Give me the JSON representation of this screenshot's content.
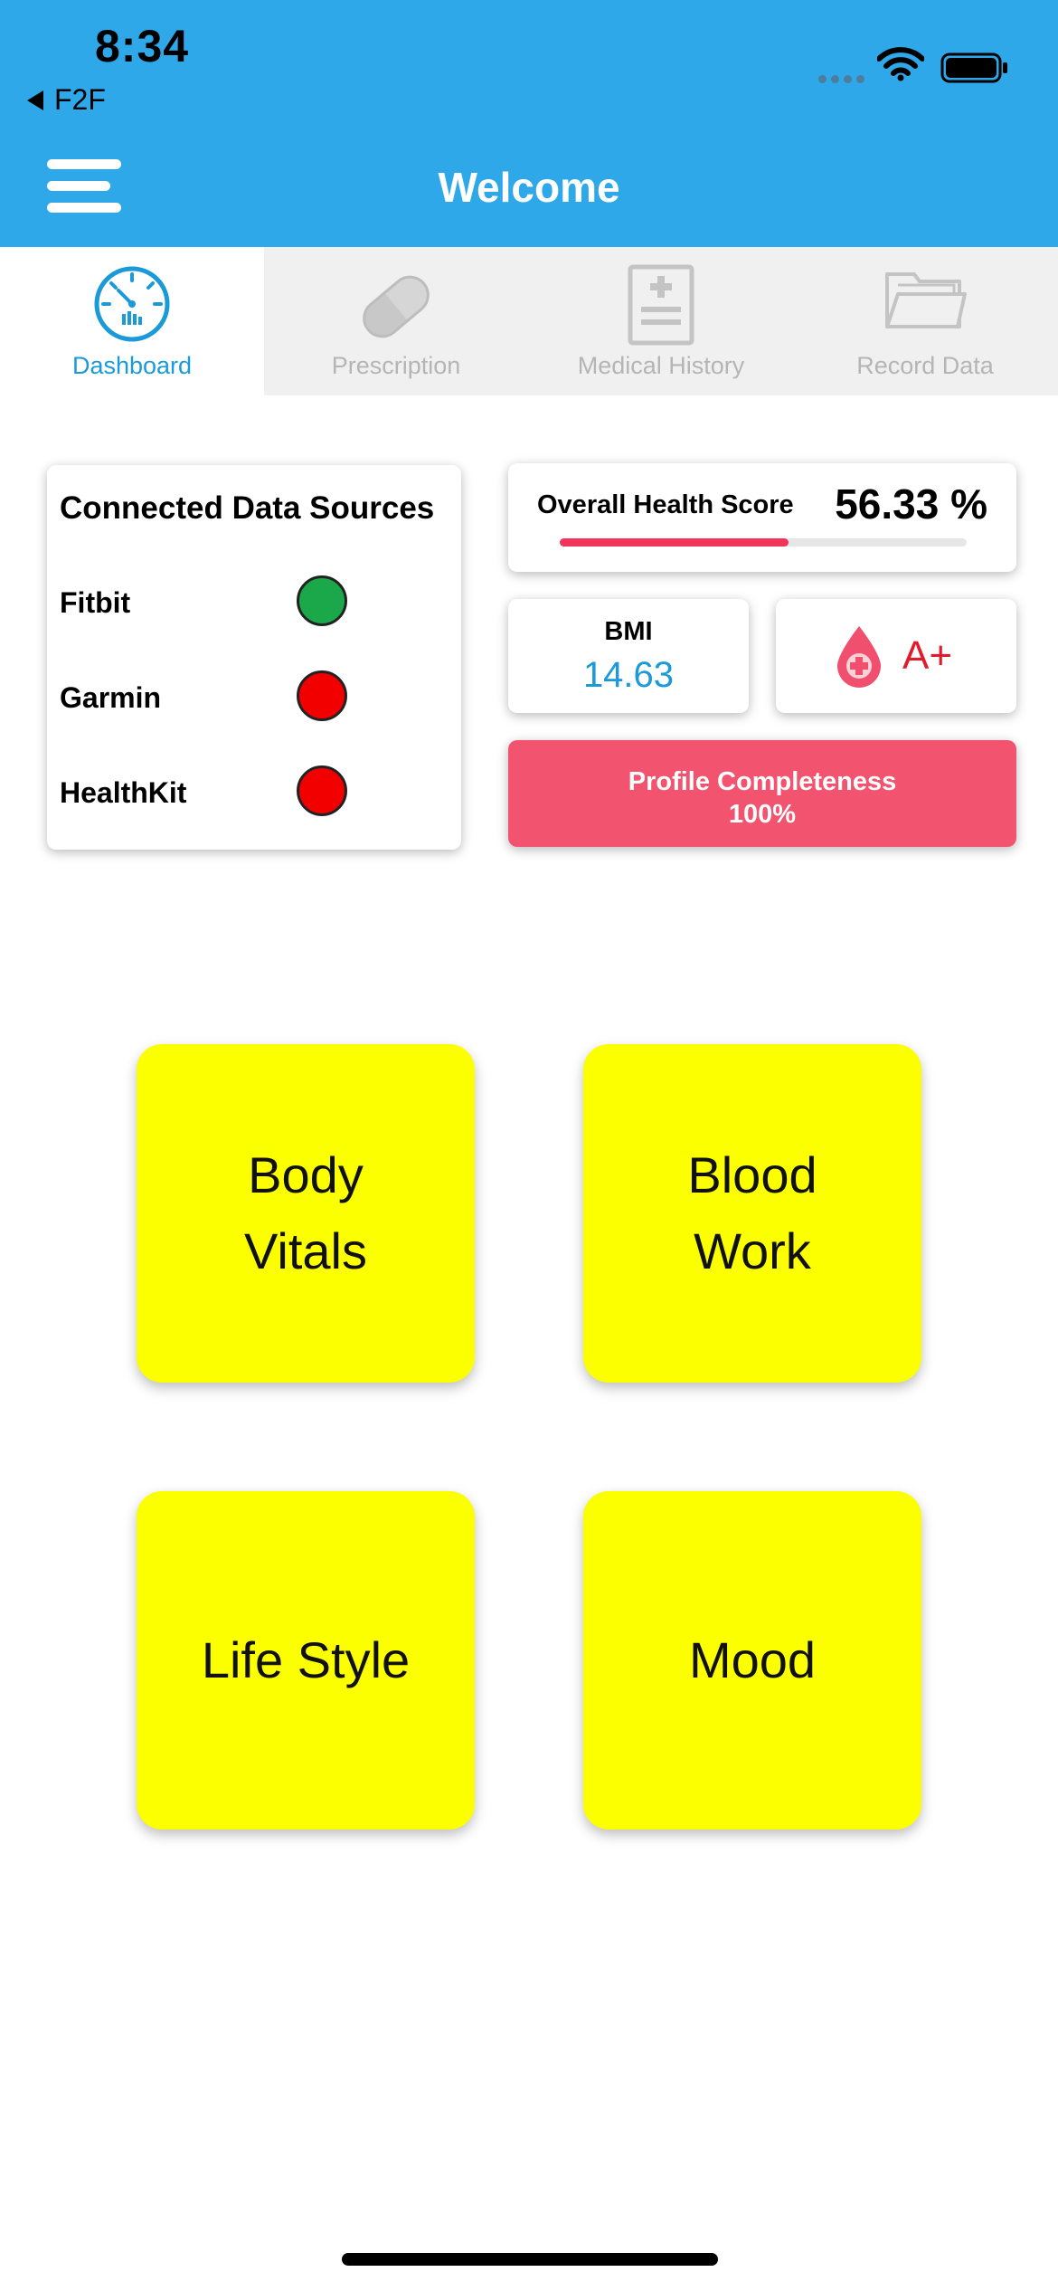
{
  "status_bar": {
    "time": "8:34",
    "back_app": "F2F",
    "icons": [
      "signal-dots-icon",
      "wifi-icon",
      "battery-icon"
    ]
  },
  "header": {
    "title": "Welcome",
    "menu_icon": "hamburger-menu-icon",
    "background": "#2ea8e8"
  },
  "tabs": [
    {
      "label": "Dashboard",
      "icon": "dashboard-gauge-icon",
      "active": true
    },
    {
      "label": "Prescription",
      "icon": "pill-icon",
      "active": false
    },
    {
      "label": "Medical History",
      "icon": "medical-report-icon",
      "active": false
    },
    {
      "label": "Record Data",
      "icon": "folder-icon",
      "active": false
    }
  ],
  "data_sources": {
    "title": "Connected Data Sources",
    "items": [
      {
        "name": "Fitbit",
        "status_color": "#1aa84a"
      },
      {
        "name": "Garmin",
        "status_color": "#f20000"
      },
      {
        "name": "HealthKit",
        "status_color": "#f20000"
      }
    ]
  },
  "health_score": {
    "label": "Overall Health Score",
    "value": "56.33 %",
    "fraction": 0.5633,
    "bar_color": "#f0345a"
  },
  "bmi": {
    "label": "BMI",
    "value": "14.63"
  },
  "blood_type": {
    "value": "A+",
    "icon": "blood-drop-icon"
  },
  "profile_completeness": {
    "label": "Profile Completeness",
    "value": "100%",
    "color": "#f25470"
  },
  "tiles": {
    "body_vitals": "Body\nVitals",
    "blood_work": "Blood\nWork",
    "life_style": "Life Style",
    "mood": "Mood",
    "color": "#fbff00"
  }
}
